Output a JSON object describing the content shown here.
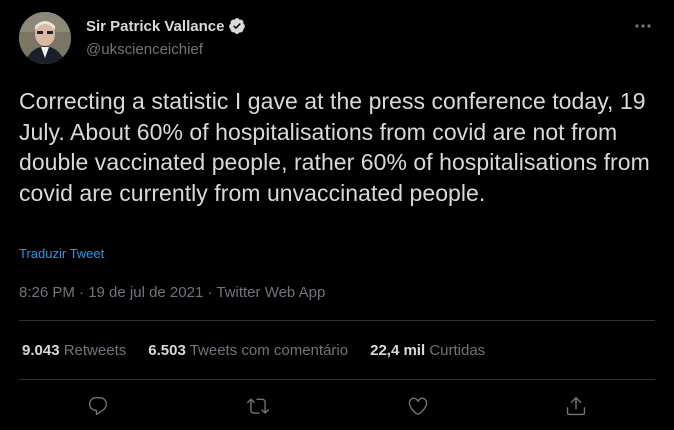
{
  "author": {
    "name": "Sir Patrick Vallance",
    "handle": "@ukscienceichief"
  },
  "tweet": {
    "text": "Correcting a statistic I gave at the press conference today, 19 July. About 60% of hospitalisations from covid are not from double vaccinated people, rather 60% of hospitalisations from covid are currently from unvaccinated people.",
    "translate_label": "Traduzir Tweet",
    "timestamp": "8:26 PM · 19 de jul de 2021 · Twitter Web App"
  },
  "stats": [
    {
      "count": "9.043",
      "label": "Retweets"
    },
    {
      "count": "6.503",
      "label": "Tweets com comentário"
    },
    {
      "count": "22,4 mil",
      "label": "Curtidas"
    }
  ],
  "actions": {
    "reply": "reply-icon",
    "retweet": "retweet-icon",
    "like": "heart-icon",
    "share": "share-icon"
  },
  "colors": {
    "background": "#000000",
    "text": "#d9d9d9",
    "secondary": "#6e767d",
    "link": "#1d9bf0",
    "divider": "#2f3336"
  }
}
